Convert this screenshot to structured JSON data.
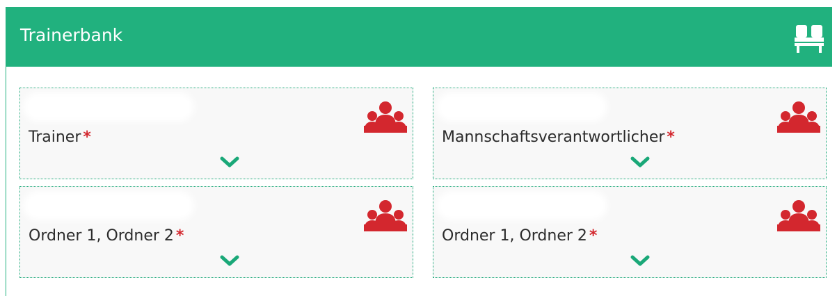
{
  "header": {
    "title": "Trainerbank",
    "icon": "bench-icon",
    "background": "#21b17e"
  },
  "cards": [
    {
      "label": "Trainer",
      "required": "*",
      "icon": "team-icon",
      "value": ""
    },
    {
      "label": "Mannschaftsverantwortlicher",
      "required": "*",
      "icon": "team-icon",
      "value": ""
    },
    {
      "label": "Ordner 1, Ordner 2",
      "required": "*",
      "icon": "team-icon",
      "value": ""
    },
    {
      "label": "Ordner 1, Ordner 2",
      "required": "*",
      "icon": "team-icon",
      "value": ""
    }
  ],
  "colors": {
    "accent": "#21b17e",
    "icon_red": "#d3272e",
    "required_red": "#d3272e",
    "card_bg": "#f8f8f8"
  }
}
